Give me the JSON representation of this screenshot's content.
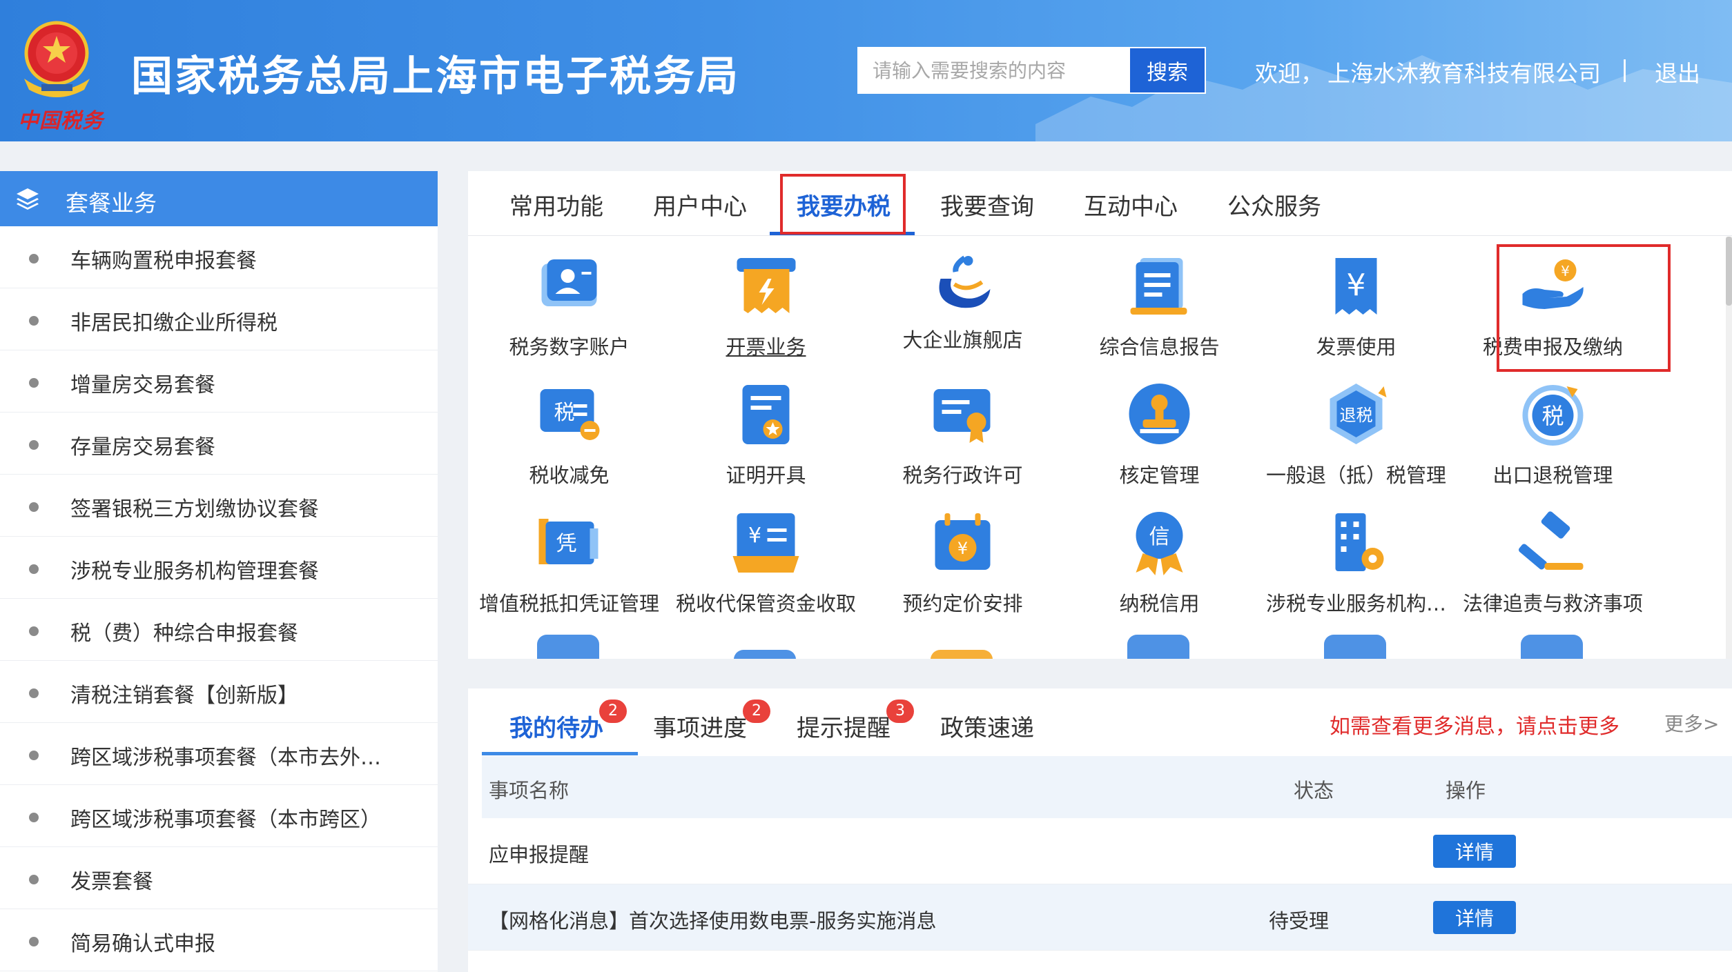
{
  "header": {
    "title": "国家税务总局上海市电子税务局",
    "emblem_caption": "中国税务",
    "search_placeholder": "请输入需要搜索的内容",
    "search_button": "搜索",
    "welcome": "欢迎，",
    "company": "上海水沐教育科技有限公司",
    "separator": "|",
    "logout": "退出"
  },
  "sidebar": {
    "title": "套餐业务",
    "items": [
      "车辆购置税申报套餐",
      "非居民扣缴企业所得税",
      "增量房交易套餐",
      "存量房交易套餐",
      "签署银税三方划缴协议套餐",
      "涉税专业服务机构管理套餐",
      "税（费）种综合申报套餐",
      "清税注销套餐【创新版】",
      "跨区域涉税事项套餐（本市去外…",
      "跨区域涉税事项套餐（本市跨区）",
      "发票套餐",
      "简易确认式申报"
    ]
  },
  "tabs": [
    "常用功能",
    "用户中心",
    "我要办税",
    "我要查询",
    "互动中心",
    "公众服务"
  ],
  "services": [
    {
      "label": "税务数字账户",
      "icon": "digital-account-icon"
    },
    {
      "label": "开票业务",
      "icon": "invoice-issue-icon"
    },
    {
      "label": "大企业旗舰店",
      "icon": "enterprise-store-icon"
    },
    {
      "label": "综合信息报告",
      "icon": "info-report-icon"
    },
    {
      "label": "发票使用",
      "icon": "invoice-use-icon"
    },
    {
      "label": "税费申报及缴纳",
      "icon": "tax-payment-icon"
    },
    {
      "label": "税收减免",
      "icon": "tax-reduction-icon"
    },
    {
      "label": "证明开具",
      "icon": "certificate-icon"
    },
    {
      "label": "税务行政许可",
      "icon": "admin-permit-icon"
    },
    {
      "label": "核定管理",
      "icon": "stamp-icon"
    },
    {
      "label": "一般退（抵）税管理",
      "icon": "tax-refund-icon"
    },
    {
      "label": "出口退税管理",
      "icon": "export-refund-icon"
    },
    {
      "label": "增值税抵扣凭证管理",
      "icon": "voucher-icon"
    },
    {
      "label": "税收代保管资金收取",
      "icon": "fund-custody-icon"
    },
    {
      "label": "预约定价安排",
      "icon": "pricing-calendar-icon"
    },
    {
      "label": "纳税信用",
      "icon": "credit-icon"
    },
    {
      "label": "涉税专业服务机构…",
      "icon": "agency-building-icon"
    },
    {
      "label": "法律追责与救济事项",
      "icon": "gavel-icon"
    }
  ],
  "todo": {
    "tabs": [
      {
        "label": "我的待办",
        "badge": "2"
      },
      {
        "label": "事项进度",
        "badge": "2"
      },
      {
        "label": "提示提醒",
        "badge": "3"
      },
      {
        "label": "政策速递",
        "badge": ""
      }
    ],
    "more_message": "如需查看更多消息，请点击更多",
    "more_link": "更多>",
    "columns": [
      "事项名称",
      "状态",
      "操作"
    ],
    "rows": [
      {
        "name": "应申报提醒",
        "status": "",
        "action": "详情"
      },
      {
        "name": "【网格化消息】首次选择使用数电票-服务实施消息",
        "status": "待受理",
        "action": "详情"
      }
    ]
  },
  "colors": {
    "primary": "#1e63d6",
    "header_gradient_start": "#2f7fdc",
    "highlight_red": "#e02b2b",
    "badge_red": "#e9413b"
  }
}
